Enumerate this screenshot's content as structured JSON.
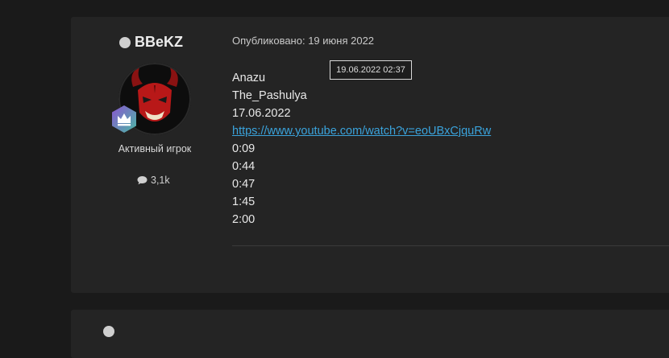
{
  "post": {
    "author": {
      "name": "BBeKZ",
      "role": "Активный игрок",
      "message_count": "3,1k",
      "status_color": "#cfcfcf"
    },
    "published_label": "Опубликовано: 19 июня 2022",
    "tooltip": "19.06.2022 02:37",
    "content": {
      "lines": [
        "Anazu",
        "The_Pashulya",
        "17.06.2022"
      ],
      "link": "https://www.youtube.com/watch?v=eoUBxCjquRw",
      "timestamps": [
        "0:09",
        "0:44",
        "0:47",
        "1:45",
        "2:00"
      ]
    }
  },
  "colors": {
    "page_bg": "#1a1a1a",
    "card_bg": "#242424",
    "link": "#3aa3dc",
    "badge": "#7e4fbf"
  }
}
